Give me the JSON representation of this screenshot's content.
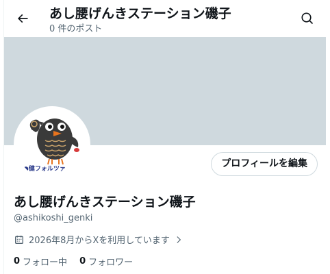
{
  "header": {
    "title": "あし腰げんきステーション磯子",
    "post_count": "0 件のポスト"
  },
  "avatar": {
    "caption": "●健フォルツァ",
    "description": "bird mascot giving OK sign"
  },
  "profile": {
    "edit_label": "プロフィールを編集",
    "display_name": "あし腰げんきステーション磯子",
    "handle": "@ashikoshi_genki",
    "joined": "2026年8月からXを利用しています"
  },
  "stats": {
    "following_count": "0",
    "following_label": "フォロー中",
    "followers_count": "0",
    "followers_label": "フォロワー"
  },
  "icons": {
    "back": "back-arrow-icon",
    "search": "search-icon",
    "calendar": "calendar-icon",
    "chevron": "chevron-right-icon"
  },
  "colors": {
    "banner": "#cfd9de",
    "text_primary": "#0f1419",
    "text_secondary": "#536471",
    "border": "#cfd9de"
  }
}
